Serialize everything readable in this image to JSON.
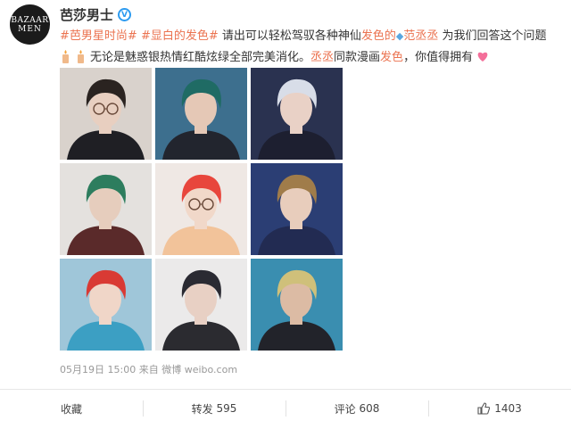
{
  "account": {
    "avatar_line1": "BAZAAR",
    "avatar_line2": "MEN",
    "name": "芭莎男士"
  },
  "post": {
    "line1": [
      {
        "text": "#芭男星时尚#",
        "kind": "topic"
      },
      {
        "text": " ",
        "kind": "plain"
      },
      {
        "text": "#显白的发色#",
        "kind": "topic"
      },
      {
        "text": " 请出可以轻松驾驭各种神仙",
        "kind": "plain"
      },
      {
        "text": "发色的",
        "kind": "hl"
      },
      {
        "text": "范丞丞",
        "kind": "at"
      },
      {
        "text": " 为我们回答这个问题",
        "kind": "plain"
      }
    ],
    "line2": [
      {
        "text": "无论是魅惑银热情红酷炫绿全部完美消化。",
        "kind": "plain"
      },
      {
        "text": "丞丞",
        "kind": "hl"
      },
      {
        "text": "同款漫画",
        "kind": "plain"
      },
      {
        "text": "发色",
        "kind": "hl"
      },
      {
        "text": "，你值得拥有",
        "kind": "plain"
      }
    ]
  },
  "meta": {
    "date": "05月19日 15:00",
    "source_prefix": "来自",
    "source": "微博 weibo.com"
  },
  "actions": {
    "favorite": "收藏",
    "repost_label": "转发",
    "repost_count": "595",
    "comment_label": "评论",
    "comment_count": "608",
    "like_count": "1403"
  },
  "photos": [
    {
      "bg": "#d9d2cc",
      "hair": "#2a2320",
      "skin": "#e8cfc0",
      "cloth": "#1f1f24",
      "glasses": true
    },
    {
      "bg": "#3d6f8e",
      "hair": "#1f6b64",
      "skin": "#e5c8b6",
      "cloth": "#22252e",
      "glasses": false
    },
    {
      "bg": "#2a3250",
      "hair": "#d8dde8",
      "skin": "#e9d1c6",
      "cloth": "#1d1f30",
      "glasses": false
    },
    {
      "bg": "#e4e1de",
      "hair": "#2d7d5e",
      "skin": "#e6cdbd",
      "cloth": "#5a2a2a",
      "glasses": false
    },
    {
      "bg": "#efe8e4",
      "hair": "#e8463c",
      "skin": "#f1d8c9",
      "cloth": "#f2c39a",
      "glasses": true
    },
    {
      "bg": "#2b3e74",
      "hair": "#a07c4a",
      "skin": "#e8cdbc",
      "cloth": "#222b52",
      "glasses": false
    },
    {
      "bg": "#9fc6d9",
      "hair": "#d93a34",
      "skin": "#f0d6c8",
      "cloth": "#3c9fc3",
      "glasses": false
    },
    {
      "bg": "#ebeaea",
      "hair": "#2a2a32",
      "skin": "#e8d0c4",
      "cloth": "#2b2b30",
      "glasses": false
    },
    {
      "bg": "#3a8eb0",
      "hair": "#cfc07a",
      "skin": "#dcbba4",
      "cloth": "#22232a",
      "glasses": false
    }
  ]
}
